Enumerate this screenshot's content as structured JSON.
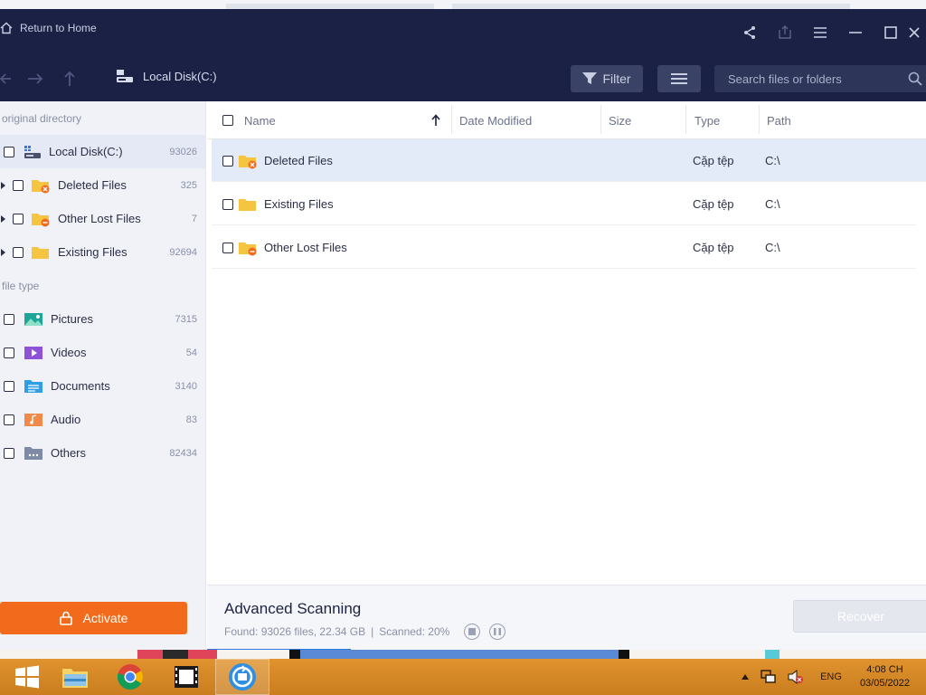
{
  "titlebar": {
    "home_label": "Return to Home"
  },
  "toolbar": {
    "breadcrumb": "Local Disk(C:)",
    "filter_label": "Filter",
    "search_placeholder": "Search files or folders"
  },
  "sidebar": {
    "section_directory": "original directory",
    "directory_items": [
      {
        "label": "Local Disk(C:)",
        "count": "93026"
      },
      {
        "label": "Deleted Files",
        "count": "325"
      },
      {
        "label": "Other Lost Files",
        "count": "7"
      },
      {
        "label": "Existing Files",
        "count": "92694"
      }
    ],
    "section_filetype": "file type",
    "filetype_items": [
      {
        "label": "Pictures",
        "count": "7315"
      },
      {
        "label": "Videos",
        "count": "54"
      },
      {
        "label": "Documents",
        "count": "3140"
      },
      {
        "label": "Audio",
        "count": "83"
      },
      {
        "label": "Others",
        "count": "82434"
      }
    ],
    "activate_label": "Activate"
  },
  "table": {
    "columns": [
      "Name",
      "Date Modified",
      "Size",
      "Type",
      "Path"
    ],
    "rows": [
      {
        "name": "Deleted Files",
        "date": "",
        "size": "",
        "type": "Cặp tệp",
        "path": "C:\\"
      },
      {
        "name": "Existing Files",
        "date": "",
        "size": "",
        "type": "Cặp tệp",
        "path": "C:\\"
      },
      {
        "name": "Other Lost Files",
        "date": "",
        "size": "",
        "type": "Cặp tệp",
        "path": "C:\\"
      }
    ]
  },
  "footer": {
    "title": "Advanced Scanning",
    "found": "Found: 93026 files, 22.34 GB",
    "separator": "|",
    "scanned": "Scanned: 20%",
    "scan_progress": 0.2,
    "recover_label": "Recover"
  },
  "taskbar": {
    "language": "ENG",
    "time": "4:08 CH",
    "date": "03/05/2022"
  },
  "colors": {
    "app_header": "#1a2145",
    "accent_orange": "#f26b1d",
    "selection": "#e4ebf8",
    "progress": "#2f7be3"
  }
}
